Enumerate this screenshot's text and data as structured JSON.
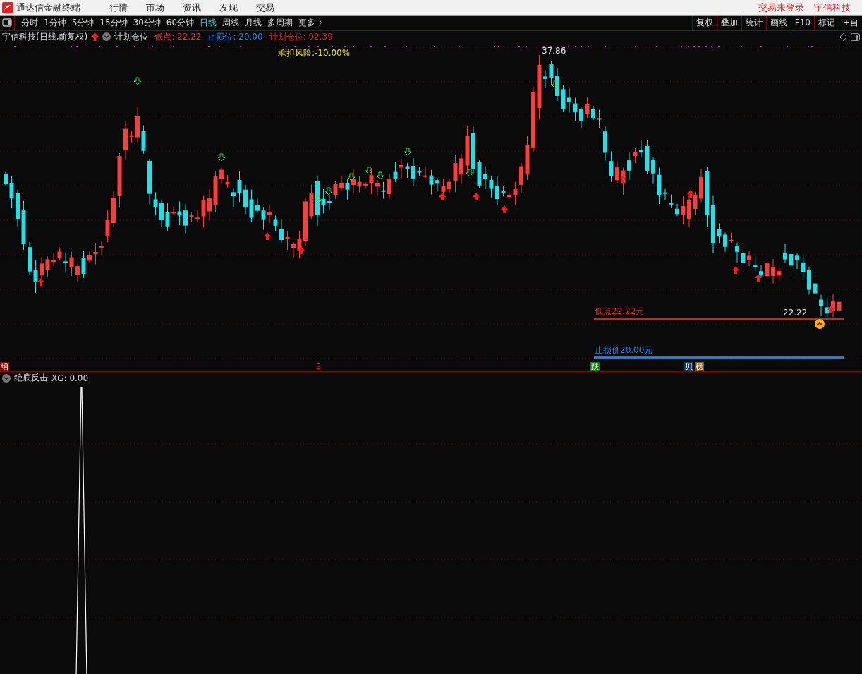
{
  "title_bar": {
    "app_name": "通达信金融终端",
    "menu": [
      "行情",
      "市场",
      "资讯",
      "发现",
      "交易"
    ],
    "login_status": "交易未登录",
    "stock_name": "宇信科技"
  },
  "period_tabs": [
    {
      "label": "分时",
      "selected": false
    },
    {
      "label": "1分钟",
      "selected": false
    },
    {
      "label": "5分钟",
      "selected": false
    },
    {
      "label": "15分钟",
      "selected": false
    },
    {
      "label": "30分钟",
      "selected": false
    },
    {
      "label": "60分钟",
      "selected": false
    },
    {
      "label": "日线",
      "selected": true
    },
    {
      "label": "周线",
      "selected": false
    },
    {
      "label": "月线",
      "selected": false
    },
    {
      "label": "多周期",
      "selected": false
    },
    {
      "label": "更多 〉",
      "selected": false
    }
  ],
  "tools": [
    "复权",
    "叠加",
    "统计",
    "画线",
    "F10",
    "标记",
    "+自"
  ],
  "main_chart": {
    "stock_label": "宇信科技(日线,前复权)",
    "indicator_name": "计划仓位",
    "values": [
      {
        "text": "低点: 22.22",
        "color": "#ff2a2a"
      },
      {
        "text": "止损位: 20.00",
        "color": "#1e88ff"
      },
      {
        "text": "计划仓位: 92.39",
        "color": "#e02424"
      }
    ],
    "risk_label": "承担风险:-10.00%",
    "high_label": "37.86",
    "low_line_label": "低点22.22元",
    "low_price_label": "22.22",
    "stop_line_label": "止损价20.00元",
    "event_badges": [
      {
        "text": "增",
        "color": "#8b0000"
      },
      {
        "text": "S",
        "color": "#0a0a0a"
      },
      {
        "text": "跌",
        "color": "#0f7a0f"
      },
      {
        "text": "贝",
        "color": "#123a6a"
      },
      {
        "text": "榜",
        "color": "#8a4a10"
      }
    ]
  },
  "sub_chart": {
    "indicator_name": "绝底反击",
    "reading": "XG: 0.00"
  }
}
